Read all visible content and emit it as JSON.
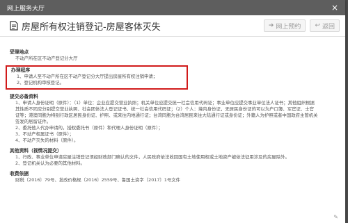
{
  "window_title": "网上服务大厅",
  "close_glyph": "×",
  "page_title": "房屋所有权注销登记-房屋客体灭失",
  "buttons": {
    "appointment": "网上预约",
    "back": "返回"
  },
  "sections": {
    "location": {
      "title": "受理地点",
      "items": [
        "不动产所在区不动产登记分大厅"
      ]
    },
    "procedure": {
      "title": "办理程序",
      "items": [
        "1、申请人至不动产所在区不动产登记分大厅提出房屋所有权注销申请；",
        "2、登记机构审核登记。"
      ]
    },
    "materials": {
      "title": "提交必备资料",
      "items": [
        "1、申请人身份证明（原件）：（1）单位：企业应提交营业执照；机关单位应提交统一社会信用代码证；事业单位应提交事业单位法人证书；其他组织根据",
        "其性质不同应分别提交营业执照、社会团体法人登记证书、统一社会信用代码证；（2）个人：境内身份证，无居民身份证的可以为户口簿、军官证、士官",
        "证等；港澳同胞为特别行政区居民身份证、护照、或来往内地通行证；台湾同胞为台湾居民来往大陆通行证或身份证；外籍人为护照或者中国政府主管机关",
        "签发的居留证件。",
        "2、委托他人代办申请的，授权委托书（原件）和代理人身份证明（原件）；",
        "3、不动产权属证书（原件）；",
        "4、不动产灭失的材料（原件）。"
      ]
    },
    "other": {
      "title": "其他资料（视情况提交）",
      "items": [
        "1、行政、事业单位申请房屋注销登记须经财政部门确认的文件，人民政府依法收回国有土地使用权或土地资产被依法征用涉及的房屋除外。",
        "2、登记机关认为必要的其他材料。"
      ]
    },
    "basis": {
      "title": "收费依据",
      "items": [
        "财税〔2016〕79号、发改价格规〔2016〕2559号、鲁国土资字〔2017〕1号文件"
      ]
    }
  },
  "colors": {
    "titlebar_bg": "#5e5e5e",
    "highlight_border": "#d11a1a"
  }
}
